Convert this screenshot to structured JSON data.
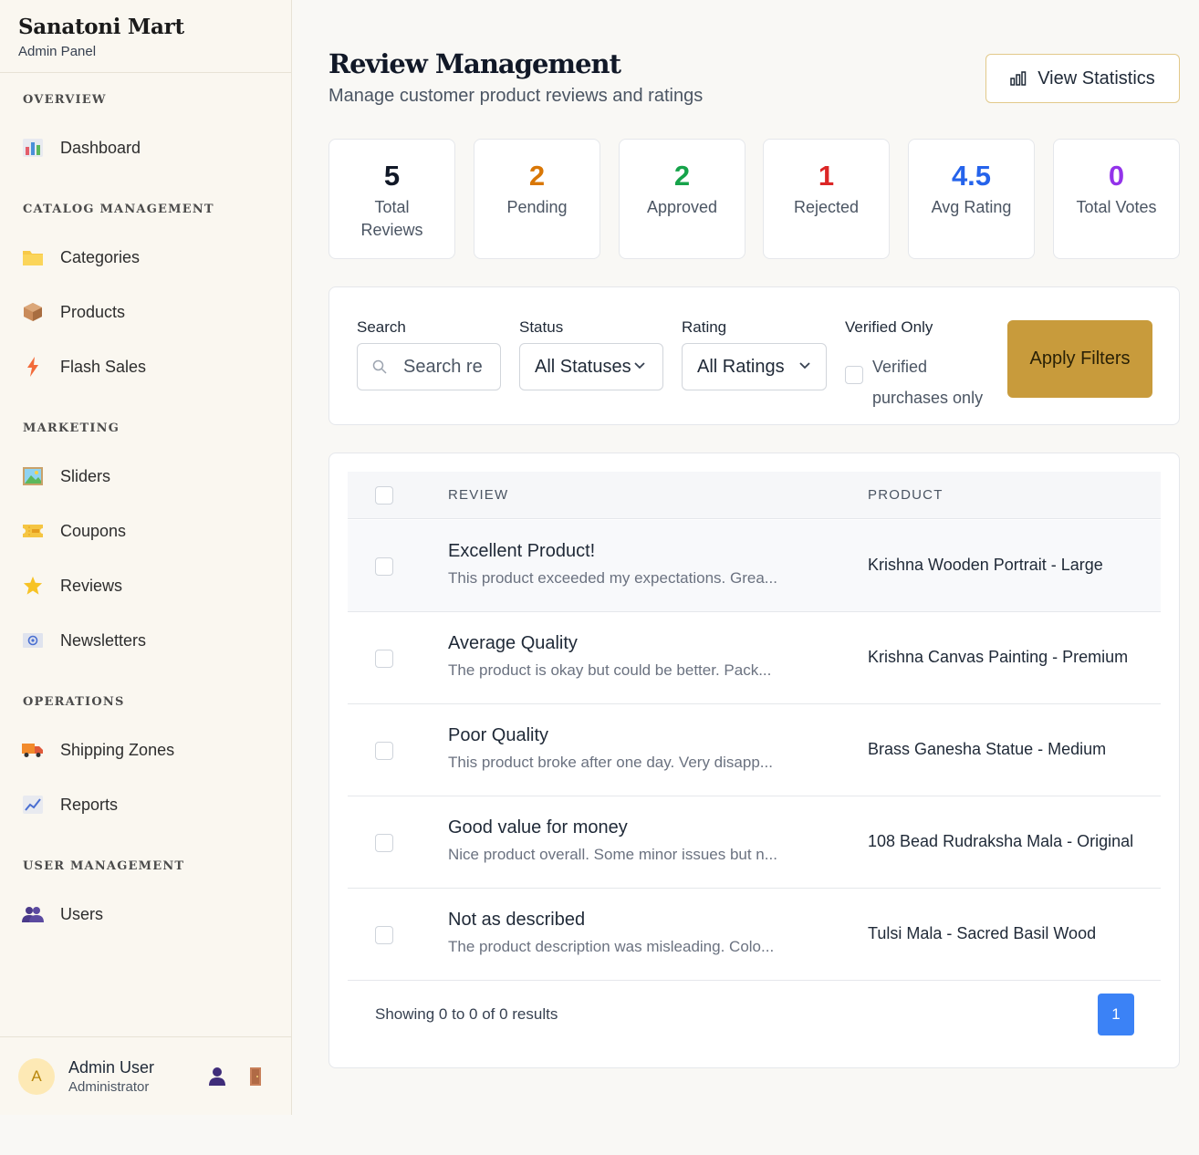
{
  "brand": {
    "name": "Sanatoni Mart",
    "subtitle": "Admin Panel"
  },
  "nav": {
    "sections": [
      "OVERVIEW",
      "CATALOG MANAGEMENT",
      "MARKETING",
      "OPERATIONS",
      "USER MANAGEMENT"
    ],
    "items": [
      {
        "label": "Dashboard",
        "icon": "bar-chart-icon"
      },
      {
        "label": "Categories",
        "icon": "folder-icon"
      },
      {
        "label": "Products",
        "icon": "package-icon"
      },
      {
        "label": "Flash Sales",
        "icon": "lightning-icon"
      },
      {
        "label": "Sliders",
        "icon": "picture-icon"
      },
      {
        "label": "Coupons",
        "icon": "ticket-icon"
      },
      {
        "label": "Reviews",
        "icon": "star-icon"
      },
      {
        "label": "Newsletters",
        "icon": "envelope-icon"
      },
      {
        "label": "Shipping Zones",
        "icon": "truck-icon"
      },
      {
        "label": "Reports",
        "icon": "line-chart-icon"
      },
      {
        "label": "Users",
        "icon": "users-icon"
      }
    ]
  },
  "user": {
    "initial": "A",
    "name": "Admin User",
    "role": "Administrator"
  },
  "header": {
    "title": "Review Management",
    "subtitle": "Manage customer product reviews and ratings",
    "stats_button": "View Statistics"
  },
  "stats": [
    {
      "value": "5",
      "label": "Total Reviews",
      "color": "#111827"
    },
    {
      "value": "2",
      "label": "Pending",
      "color": "#d97706"
    },
    {
      "value": "2",
      "label": "Approved",
      "color": "#16a34a"
    },
    {
      "value": "1",
      "label": "Rejected",
      "color": "#dc2626"
    },
    {
      "value": "4.5",
      "label": "Avg Rating",
      "color": "#2563eb"
    },
    {
      "value": "0",
      "label": "Total Votes",
      "color": "#9333ea"
    }
  ],
  "filters": {
    "search_label": "Search",
    "search_placeholder": "Search re",
    "status_label": "Status",
    "status_value": "All Statuses",
    "rating_label": "Rating",
    "rating_value": "All Ratings",
    "verified_label": "Verified Only",
    "verified_text": "Verified purchases only",
    "apply_button": "Apply Filters"
  },
  "table": {
    "columns": [
      "REVIEW",
      "PRODUCT"
    ],
    "rows": [
      {
        "title": "Excellent Product!",
        "desc": "This product exceeded my expectations. Grea...",
        "product": "Krishna Wooden Portrait - Large"
      },
      {
        "title": "Average Quality",
        "desc": "The product is okay but could be better. Pack...",
        "product": "Krishna Canvas Painting - Premium"
      },
      {
        "title": "Poor Quality",
        "desc": "This product broke after one day. Very disapp...",
        "product": "Brass Ganesha Statue - Medium"
      },
      {
        "title": "Good value for money",
        "desc": "Nice product overall. Some minor issues but n...",
        "product": "108 Bead Rudraksha Mala - Original"
      },
      {
        "title": "Not as described",
        "desc": "The product description was misleading. Colo...",
        "product": "Tulsi Mala - Sacred Basil Wood"
      }
    ],
    "showing": "Showing 0 to 0 of 0 results",
    "page": "1"
  }
}
